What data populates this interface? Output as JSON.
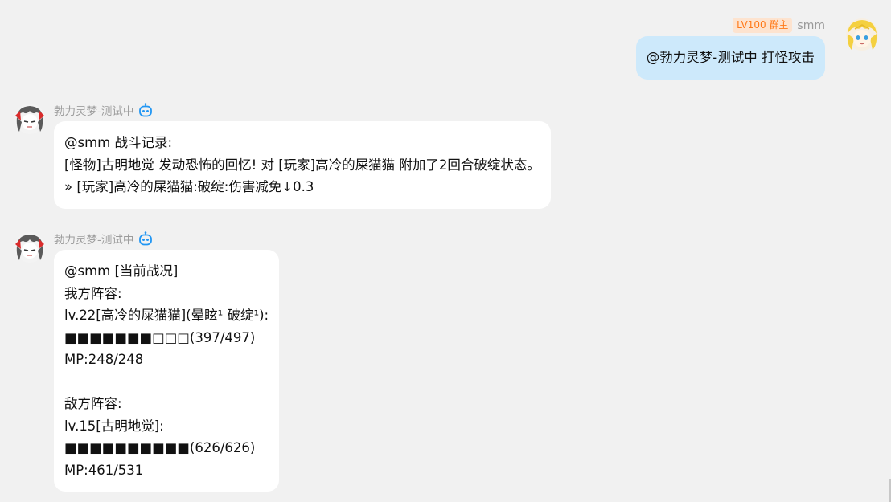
{
  "colors": {
    "background": "#f1f1f1",
    "outgoing_bubble": "#cde9fb",
    "incoming_bubble": "#ffffff",
    "badge_bg": "#fde3cf",
    "badge_text": "#ff7a1a",
    "bot_icon": "#2196f3"
  },
  "outgoing": {
    "badge": "LV100 群主",
    "sender": "smm",
    "avatar_icon": "blonde-anime-avatar-icon",
    "text": "@勃力灵梦-测试中 打怪攻击"
  },
  "messages": [
    {
      "sender": "勃力灵梦-测试中",
      "avatar_icon": "reimu-avatar-icon",
      "bot_icon": "robot-icon",
      "lines": [
        "@smm 战斗记录:",
        "[怪物]古明地觉 发动恐怖的回忆!  对 [玩家]高冷的屎猫猫 附加了2回合破绽状态。",
        "» [玩家]高冷的屎猫猫:破绽:伤害减免↓0.3"
      ]
    },
    {
      "sender": "勃力灵梦-测试中",
      "avatar_icon": "reimu-avatar-icon",
      "bot_icon": "robot-icon",
      "lines": [
        "@smm [当前战况]",
        "我方阵容:",
        "lv.22[高冷的屎猫猫](晕眩¹ 破绽¹):",
        "■■■■■■■□□□(397/497)",
        "MP:248/248",
        "",
        "敌方阵容:",
        "lv.15[古明地觉]:",
        "■■■■■■■■■■(626/626)",
        "MP:461/531"
      ]
    }
  ]
}
